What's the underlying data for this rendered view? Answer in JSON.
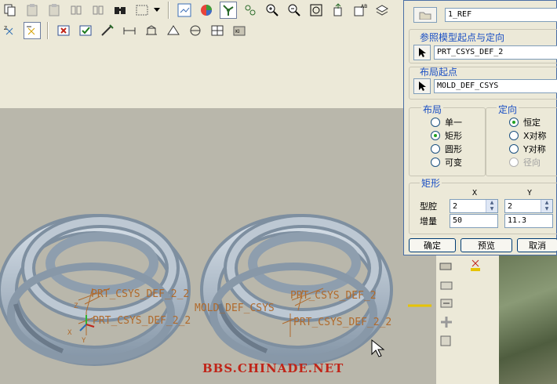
{
  "dialog": {
    "top_field_value": "1_REF",
    "ref_origin_label": "参照模型起点与定向",
    "ref_origin_value": "PRT_CSYS_DEF_2",
    "layout_origin_label": "布局起点",
    "layout_origin_value": "MOLD_DEF_CSYS",
    "layout_group_label": "布局",
    "layout_options": [
      "单一",
      "矩形",
      "圆形",
      "可变"
    ],
    "layout_selected": "矩形",
    "orient_group_label": "定向",
    "orient_options": [
      "恒定",
      "X对称",
      "Y对称",
      "径向"
    ],
    "orient_selected": "恒定",
    "orient_disabled": "径向",
    "rect_group_label": "矩形",
    "col_x": "X",
    "col_y": "Y",
    "cavity_label": "型腔",
    "cavity_x": "2",
    "cavity_y": "2",
    "increment_label": "增量",
    "increment_x": "50",
    "increment_y": "11.3",
    "ok_label": "确定",
    "preview_label": "预览",
    "cancel_label": "取消"
  },
  "viewport": {
    "label_1": "PRT_CSYS_DEF_2_2",
    "label_2": "PRT_CSYS_DEF_2",
    "label_3": "PRT_CSYS_DEF_2_2",
    "label_4": "MOLD_DEF_CSYS",
    "label_5": "PRT_CSYS_DEF_2_2",
    "label_6": "PRT_CSYS_DEF_2_2",
    "axis_x": "X",
    "axis_y": "Y",
    "axis_z": "Z"
  },
  "watermark": "BBS.CHINADE.NET",
  "colors": {
    "accent": "#1a4fc4",
    "label": "#b06a2c",
    "part": "#a9b8c6",
    "watermark": "#c02418"
  },
  "icons": [
    "copy-icon",
    "paste-icon",
    "paste-special-icon",
    "mirror-icon",
    "mirror-icon-2",
    "find-icon",
    "select-box-icon",
    "dropdown-icon",
    "repaint-icon",
    "color-icon",
    "datum-icon",
    "orient-icon",
    "zoom-in-icon",
    "zoom-out-icon",
    "refit-icon",
    "spin-center-icon",
    "view-icon",
    "layers-icon"
  ]
}
